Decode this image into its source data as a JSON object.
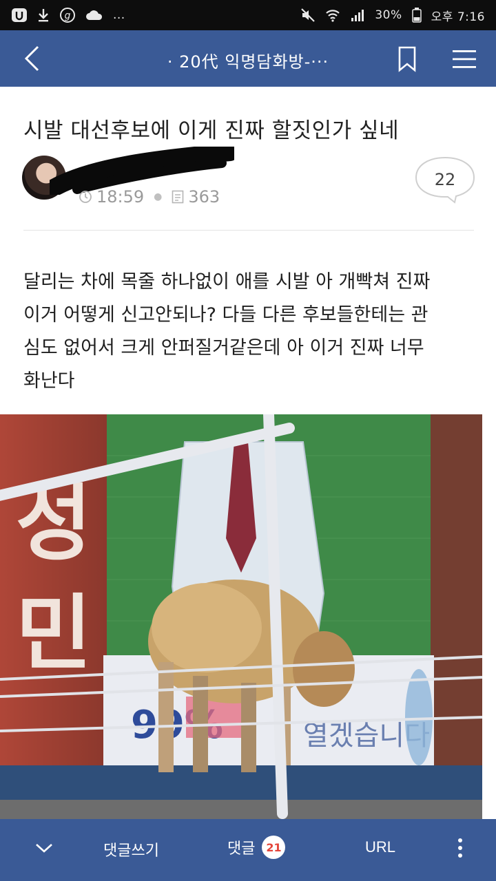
{
  "status_bar": {
    "left_icons": [
      "usb-debug-icon",
      "download-icon",
      "g-app-icon",
      "cloud-icon"
    ],
    "more": "...",
    "battery": "30%",
    "time": "오후 7:16",
    "right_icons": [
      "mute-icon",
      "wifi-icon",
      "signal-icon",
      "battery-icon"
    ]
  },
  "header": {
    "title": "· 20代 익명담화방-···",
    "back_icon": "back-chevron-icon",
    "bookmark_icon": "bookmark-icon",
    "menu_icon": "hamburger-menu-icon"
  },
  "post": {
    "title": "시발 대선후보에 이게 진짜 할짓인가 싶네",
    "author": "",
    "time": "18:59",
    "views": "363",
    "comment_count": "22",
    "body_lines": [
      "달리는 차에 목줄 하나없이 애를 시발 아 개빡쳐 진짜",
      "이거 어떻게 신고안되나? 다들 다른 후보들한테는 관",
      "심도 없어서 크게 안퍼질거같은데 아 이거 진짜 너무",
      "화난다"
    ]
  },
  "photo": {
    "signboard_left_text": "성민",
    "banner_text": "99%",
    "banner_right_text": "열겠습니다"
  },
  "bottom_bar": {
    "write_label": "댓글쓰기",
    "comments_label": "댓글",
    "comments_badge": "21",
    "url_label": "URL",
    "collapse_icon": "chevron-down-icon",
    "more_icon": "more-vertical-icon"
  },
  "colors": {
    "header_bg": "#3a5a96",
    "status_bg": "#0d0d0d",
    "badge_text": "#e4453a"
  }
}
